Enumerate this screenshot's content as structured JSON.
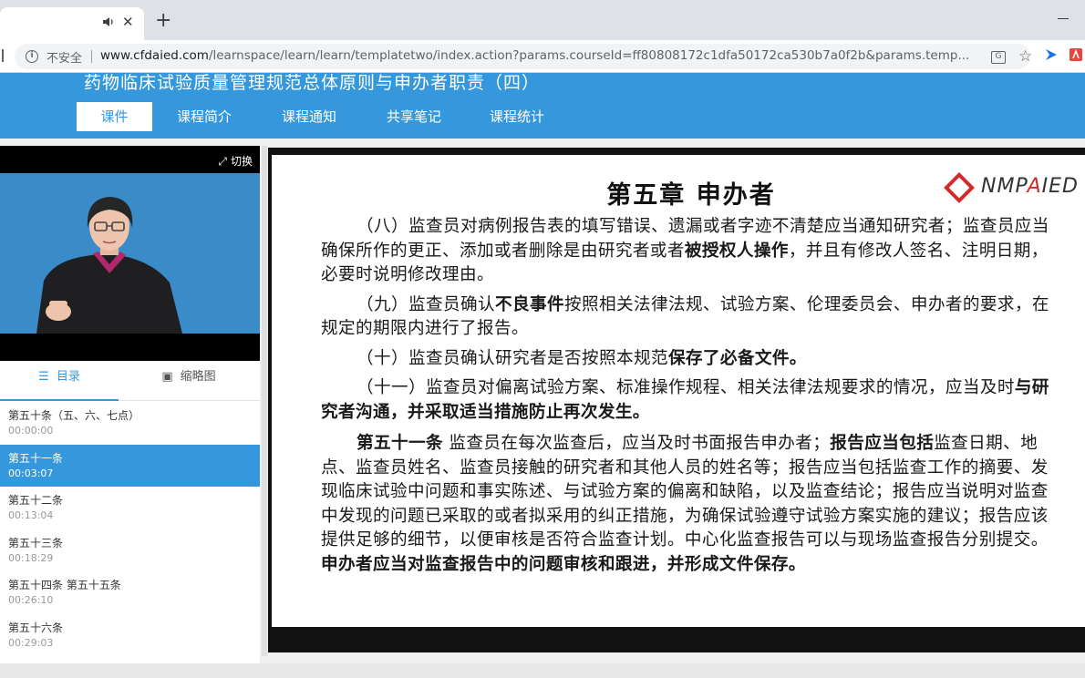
{
  "browser": {
    "tab_close": "✕",
    "new_tab": "+",
    "insecure_label": "不安全",
    "url_host": "www.cfdaied.com",
    "url_path": "/learnspace/learn/learn/templatetwo/index.action?params.courseId=ff80808172c1dfa50172ca530b7a0f2b&params.temp..."
  },
  "header": {
    "course_title": "药物临床试验质量管理规范总体原则与申办者职责（四）",
    "nav": [
      "课件",
      "课程简介",
      "课程通知",
      "共享笔记",
      "课程统计"
    ]
  },
  "video": {
    "switch_label": "切换"
  },
  "sidebar": {
    "tabs": [
      "目录",
      "缩略图"
    ],
    "chapters": [
      {
        "title": "第五十条（五、六、七点）",
        "time": "00:00:00"
      },
      {
        "title": "第五十一条",
        "time": "00:03:07"
      },
      {
        "title": "第五十二条",
        "time": "00:13:04"
      },
      {
        "title": "第五十三条",
        "time": "00:18:29"
      },
      {
        "title": "第五十四条 第五十五条",
        "time": "00:26:10"
      },
      {
        "title": "第五十六条",
        "time": "00:29:03"
      }
    ]
  },
  "slide": {
    "heading": "第五章  申办者",
    "logo_text_1": "NMP",
    "logo_text_2": "A",
    "logo_text_3": "IED",
    "p1a": "（八）监查员对病例报告表的填写错误、遗漏或者字迹不清楚应当通知研究者；监查员应当确保所作的更正、添加或者删除是由研究者或者",
    "p1b": "被授权人操作",
    "p1c": "，并且有修改人签名、注明日期，必要时说明修改理由。",
    "p2a": "（九）监查员确认",
    "p2b": "不良事件",
    "p2c": "按照相关法律法规、试验方案、伦理委员会、申办者的要求，在规定的期限内进行了报告。",
    "p3a": "（十）监查员确认研究者是否按照本规范",
    "p3b": "保存了必备文件。",
    "p4a": "（十一）监查员对偏离试验方案、标准操作规程、相关法律法规要求的情况，应当及时",
    "p4b": "与研究者沟通，并采取适当措施防止再次发生。",
    "p5a": "第五十一条",
    "p5b": "  监查员在每次监查后，应当及时书面报告申办者；",
    "p5c": "报告应当包括",
    "p5d": "监查日期、地点、监查员姓名、监查员接触的研究者和其他人员的姓名等；报告应当包括监查工作的摘要、发现临床试验中问题和事实陈述、与试验方案的偏离和缺陷，以及监查结论；报告应当说明对监查中发现的问题已采取的或者拟采用的纠正措施，为确保试验遵守试验方案实施的建议；报告应该提供足够的细节，以便审核是否符合监查计划。中心化监查报告可以与现场监查报告分别提交。",
    "p5e": "申办者应当对监查报告中的问题审核和跟进，并形成文件保存。"
  }
}
